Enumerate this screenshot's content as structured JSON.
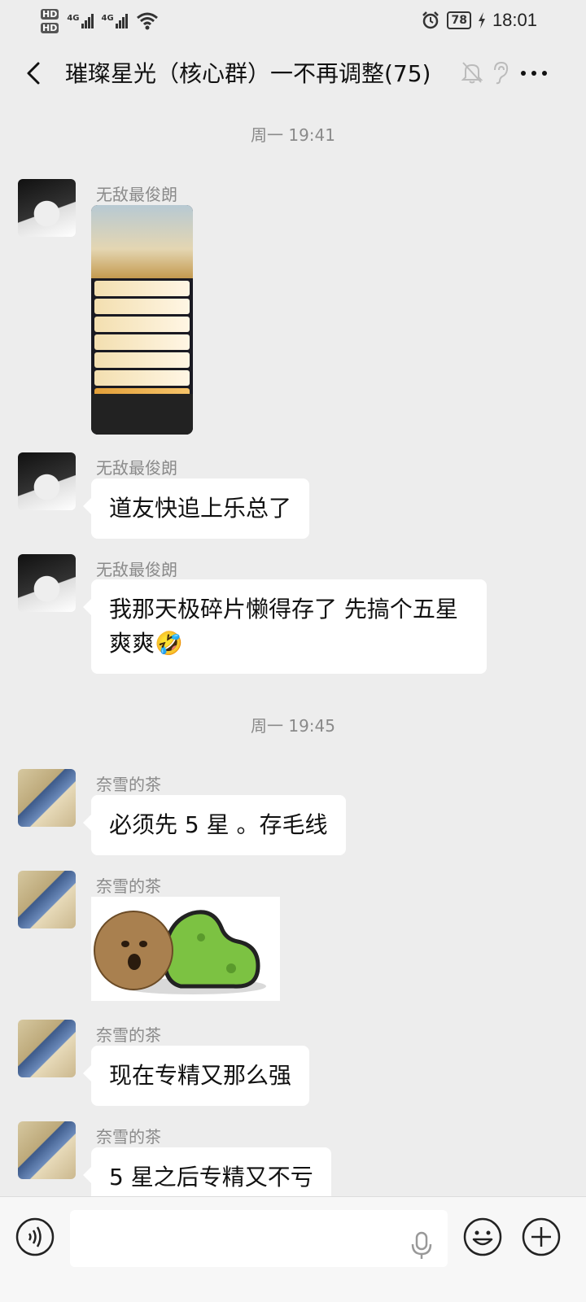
{
  "status_bar": {
    "sim1": "HD",
    "sim2": "HD",
    "net1": "4G",
    "net2": "4G",
    "battery": "78",
    "time": "18:01"
  },
  "navbar": {
    "title": "璀璨星光（核心群）一不再调整(75)",
    "icons": [
      "back-icon",
      "mute-bell-icon",
      "ear-icon",
      "more-icon"
    ]
  },
  "chat": {
    "timestamps": [
      "周一 19:41",
      "周一 19:45"
    ],
    "messages": [
      {
        "sender": "无敌最俊朗",
        "type": "image",
        "content": "game-screenshot"
      },
      {
        "sender": "无敌最俊朗",
        "type": "text",
        "text": "道友快追上乐总了"
      },
      {
        "sender": "无敌最俊朗",
        "type": "text",
        "text": "我那天极碎片懒得存了 先搞个五星爽爽",
        "emoji": "🤣"
      },
      {
        "sender": "奈雪的茶",
        "type": "text",
        "text": "必须先 5 星 。存毛线"
      },
      {
        "sender": "奈雪的茶",
        "type": "image",
        "content": "sticker"
      },
      {
        "sender": "奈雪的茶",
        "type": "text",
        "text": "现在专精又那么强"
      },
      {
        "sender": "奈雪的茶",
        "type": "text",
        "text": "5 星之后专精又不亏"
      }
    ]
  },
  "input_bar": {
    "icons": [
      "voice-icon",
      "mic-icon",
      "emoji-icon",
      "plus-icon"
    ],
    "value": ""
  }
}
